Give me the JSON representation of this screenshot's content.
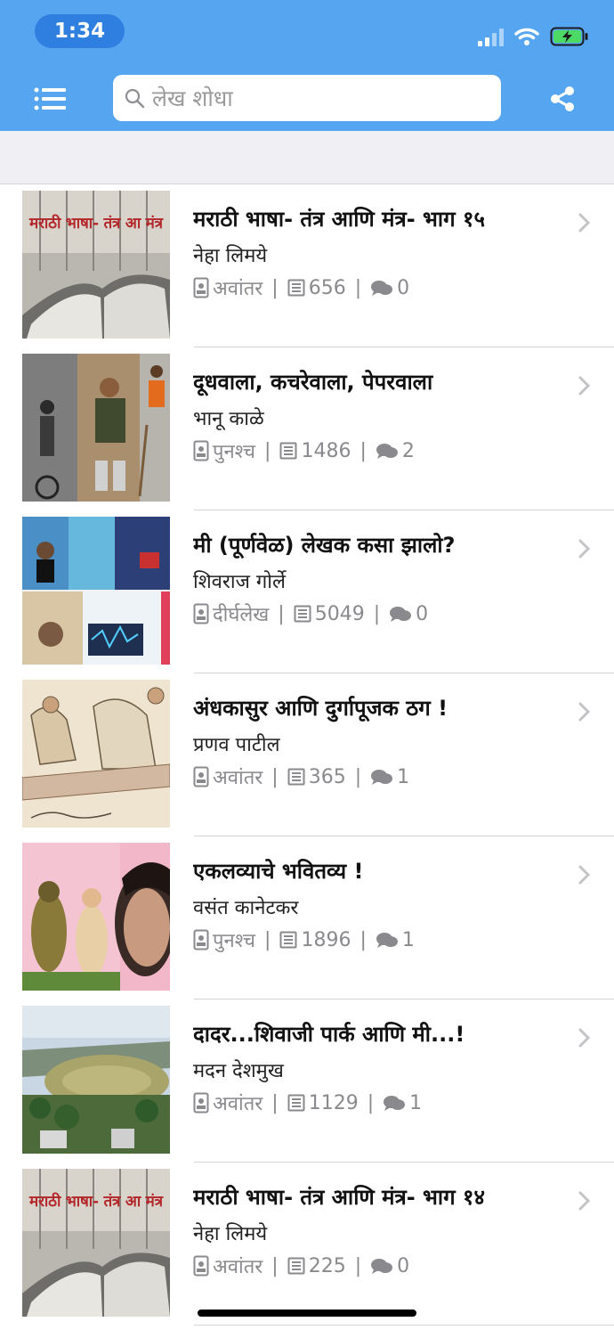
{
  "status_bar": {
    "time": "1:34"
  },
  "header": {
    "search_placeholder": "लेख शोधा"
  },
  "colors": {
    "header_bg": "#56a5f1",
    "band_bg": "#efeff4",
    "meta_gray": "#8a8a8e"
  },
  "articles": [
    {
      "title": "मराठी भाषा- तंत्र आणि मंत्र- भाग १५",
      "author": "नेहा लिमये",
      "category": "अवांतर",
      "views": "656",
      "comments": "0",
      "thumb_text": "मराठी भाषा- तंत्र आ मंत्र"
    },
    {
      "title": "दूधवाला, कचरेवाला, पेपरवाला",
      "author": "भानू काळे",
      "category": "पुनश्च",
      "views": "1486",
      "comments": "2"
    },
    {
      "title": "मी (पूर्णवेळ) लेखक कसा झालो?",
      "author": "शिवराज गोर्ले",
      "category": "दीर्घलेख",
      "views": "5049",
      "comments": "0"
    },
    {
      "title": "अंधकासुर आणि दुर्गापूजक ठग !",
      "author": "प्रणव पाटील",
      "category": "अवांतर",
      "views": "365",
      "comments": "1"
    },
    {
      "title": "एकलव्याचे भवितव्य !",
      "author": "वसंत कानेटकर",
      "category": "पुनश्च",
      "views": "1896",
      "comments": "1"
    },
    {
      "title": "दादर...शिवाजी पार्क आणि मी...!",
      "author": "मदन देशमुख",
      "category": "अवांतर",
      "views": "1129",
      "comments": "1"
    },
    {
      "title": "मराठी भाषा- तंत्र आणि मंत्र- भाग १४",
      "author": "नेहा लिमये",
      "category": "अवांतर",
      "views": "225",
      "comments": "0",
      "thumb_text": "मराठी भाषा- तंत्र आ मंत्र"
    }
  ]
}
